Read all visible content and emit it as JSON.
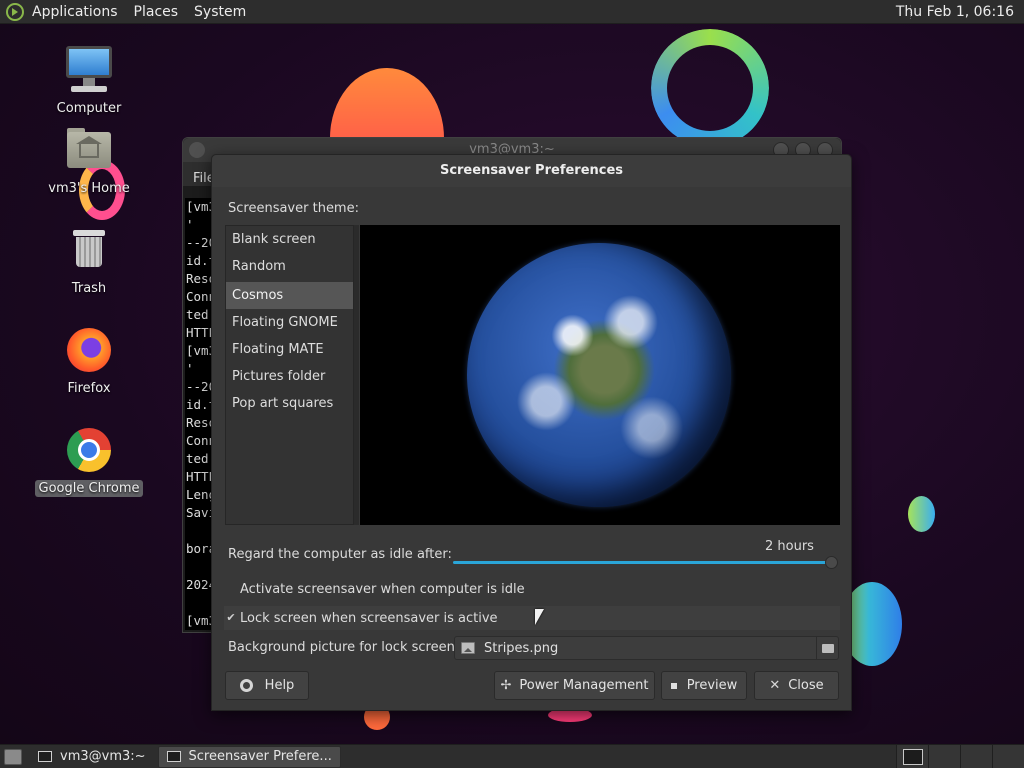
{
  "top_panel": {
    "menus": [
      "Applications",
      "Places",
      "System"
    ],
    "clock": "Thu Feb  1, 06:16"
  },
  "desktop_icons": [
    {
      "label": "Computer",
      "icon": "computer-icon"
    },
    {
      "label": "vm3's Home",
      "icon": "home-folder-icon"
    },
    {
      "label": "Trash",
      "icon": "trash-icon"
    },
    {
      "label": "Firefox",
      "icon": "firefox-icon"
    },
    {
      "label": "Google Chrome",
      "icon": "chrome-icon",
      "selected": true
    }
  ],
  "terminal": {
    "title": "vm3@vm3:~",
    "menu_first": "File",
    "lines": [
      "[vm3",
      "'",
      "--20",
      "id.t",
      "Reso",
      "Conn",
      "ted",
      "HTTP",
      "[vm3",
      "'",
      "--20",
      "id.t",
      "Reso",
      "Conn",
      "ted",
      "HTTP",
      "Leng",
      "Savi",
      "",
      "bora",
      "",
      "2024",
      "",
      "[vm3"
    ]
  },
  "dialog": {
    "title": "Screensaver Preferences",
    "theme_label": "Screensaver theme:",
    "themes": [
      "Blank screen",
      "Random",
      "Cosmos",
      "Floating GNOME",
      "Floating MATE",
      "Pictures folder",
      "Pop art squares"
    ],
    "selected_theme": "Cosmos",
    "idle_label": "Regard the computer as idle after:",
    "idle_value": "2 hours",
    "idle_fraction": 1.0,
    "activate_label": "Activate screensaver when computer is idle",
    "activate_checked": false,
    "lock_label": "Lock screen when screensaver is active",
    "lock_checked": true,
    "bg_label": "Background picture for lock screen:",
    "bg_file": "Stripes.png",
    "buttons": {
      "help": "Help",
      "power": "Power Management",
      "preview": "Preview",
      "close": "Close"
    }
  },
  "bottom_panel": {
    "tasks": [
      {
        "label": "vm3@vm3:~",
        "active": false
      },
      {
        "label": "Screensaver Prefere...",
        "active": true
      }
    ]
  },
  "colors": {
    "accent": "#2aa5d8",
    "panel": "#2d2d2d",
    "dialog_bg": "#383838"
  }
}
